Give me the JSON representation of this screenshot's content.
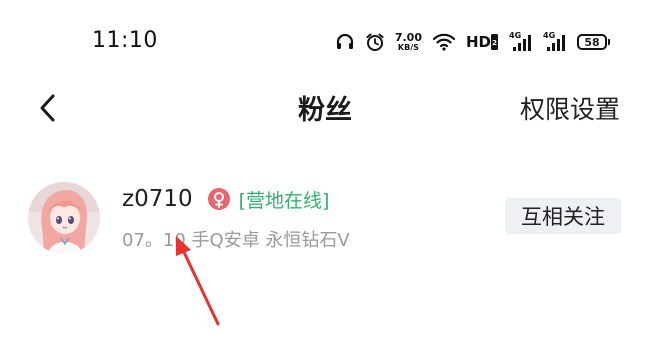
{
  "status_bar": {
    "time": "11:10",
    "speed_value": "7.00",
    "speed_unit": "KB/S",
    "hd_label": "HD",
    "signal1_label": "4G",
    "signal2_label": "4G",
    "battery_level": "58",
    "icons": [
      "headset-icon",
      "alarm-icon",
      "wifi-icon",
      "signal-icon",
      "signal-icon",
      "battery-icon"
    ]
  },
  "header": {
    "title": "粉丝",
    "right_action": "权限设置",
    "back_icon": "chevron-left-icon"
  },
  "fans": [
    {
      "username": "z0710",
      "gender_icon": "female-icon",
      "gender_color": "#e8646e",
      "online_tag": "[营地在线]",
      "online_color": "#2db36b",
      "subline": "07。10 手Q安卓 永恒钻石V",
      "action_label": "互相关注"
    }
  ],
  "annotation": {
    "arrow_color": "#e8322d"
  }
}
